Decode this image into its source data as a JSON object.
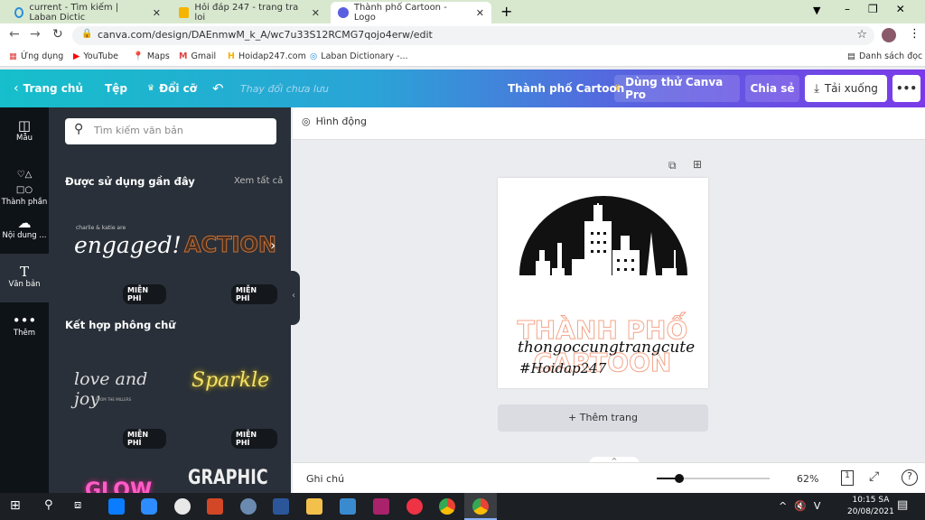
{
  "browser": {
    "tabs": [
      {
        "title": "current - Tìm kiếm | Laban Dictic"
      },
      {
        "title": "Hỏi đáp 247 - trang tra loi"
      },
      {
        "title": "Thành phố Cartoon - Logo",
        "active": true
      }
    ],
    "url": "canva.com/design/DAEnmwM_k_A/wc7u33S12RCMG7qojo4erw/edit",
    "bookmarks": [
      "Ứng dụng",
      "YouTube",
      "Maps",
      "Gmail",
      "Hoidap247.com",
      "Laban Dictionary -..."
    ],
    "reading_list": "Danh sách đọc"
  },
  "header": {
    "home": "Trang chủ",
    "file": "Tệp",
    "resize": "Đổi cỡ",
    "unsaved": "Thay đổi chưa lưu",
    "title": "Thành phố Cartoon",
    "try_pro": "Dùng thử Canva Pro",
    "share": "Chia sẻ",
    "download": "Tải xuống",
    "more": "•••"
  },
  "rail": [
    {
      "label": "Mẫu",
      "icon": "template-icon"
    },
    {
      "label": "Thành phần",
      "icon": "elements-icon"
    },
    {
      "label": "Nội dung ...",
      "icon": "upload-icon"
    },
    {
      "label": "Văn bản",
      "icon": "text-icon",
      "active": true
    },
    {
      "label": "Thêm",
      "icon": "more-icon"
    }
  ],
  "panel": {
    "search_placeholder": "Tìm kiếm văn bản",
    "recent_title": "Được sử dụng gần đây",
    "see_all": "Xem tất cả",
    "combo_title": "Kết hợp phông chữ",
    "free": "MIỄN PHÍ",
    "samples": {
      "engaged_small": "charlie & katie are",
      "engaged": "engaged!",
      "action": "ACTION",
      "love": "love and joy",
      "love_small": "FROM THE MILLERS",
      "sparkle": "Sparkle",
      "glow": "GLOW",
      "graphic": "GRAPHIC"
    }
  },
  "toolbar": {
    "animate": "Hình động"
  },
  "design": {
    "line1": "THÀNH PHỐ",
    "line2": "CARTOON",
    "script1": "thongoccungtrangcute",
    "script2": "#Hoidap247"
  },
  "canvas": {
    "add_page": "+ Thêm trang"
  },
  "bottom": {
    "notes": "Ghi chú",
    "zoom": "62%",
    "zoom_fraction": 0.2,
    "page": "1"
  },
  "taskbar": {
    "time": "10:15 SA",
    "date": "20/08/2021"
  }
}
